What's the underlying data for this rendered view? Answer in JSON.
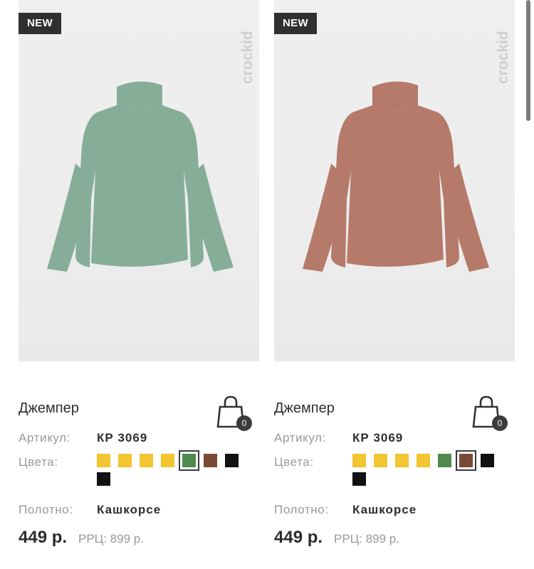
{
  "products": [
    {
      "badge": "NEW",
      "brand": "crockid",
      "title": "Джемпер",
      "article_label": "Артикул:",
      "article": "КР 3069",
      "colors_label": "Цвета:",
      "colors": [
        "#f2c531",
        "#f2c531",
        "#f2c531",
        "#f2c531",
        "#4f8a4c",
        "#7a4a35",
        "#111111",
        "#111111"
      ],
      "selected_color_index": 4,
      "fabric_label": "Полотно:",
      "fabric": "Кашкорсе",
      "price": "449 р.",
      "rrc": "РРЦ: 899 р.",
      "cart_count": "0",
      "product_color": "#86ad98"
    },
    {
      "badge": "NEW",
      "brand": "crockid",
      "title": "Джемпер",
      "article_label": "Артикул:",
      "article": "КР 3069",
      "colors_label": "Цвета:",
      "colors": [
        "#f2c531",
        "#f2c531",
        "#f2c531",
        "#f2c531",
        "#4f8a4c",
        "#7a4a35",
        "#111111",
        "#111111"
      ],
      "selected_color_index": 5,
      "fabric_label": "Полотно:",
      "fabric": "Кашкорсе",
      "price": "449 р.",
      "rrc": "РРЦ: 899 р.",
      "cart_count": "0",
      "product_color": "#b57a69"
    }
  ]
}
